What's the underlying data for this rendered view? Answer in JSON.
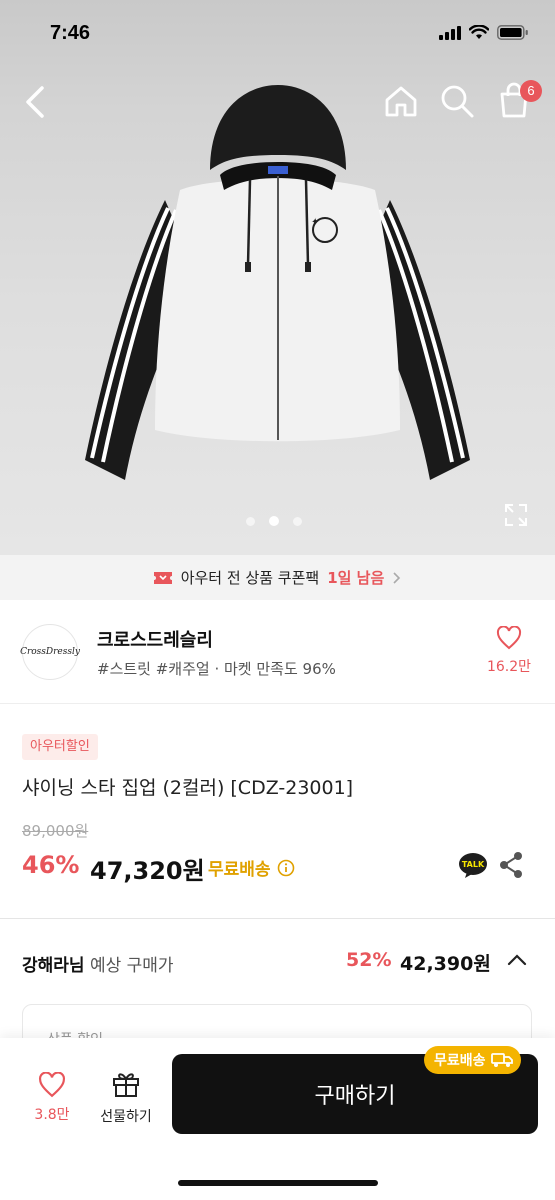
{
  "status": {
    "time": "7:46"
  },
  "nav": {
    "cart_count": "6"
  },
  "coupon": {
    "text": "아우터 전 상품 쿠폰팩",
    "remaining": "1일 남음"
  },
  "seller": {
    "logo_text": "CrossDressly",
    "name": "크로스드레슬리",
    "tags": "#스트릿 #캐주얼 · 마켓 만족도 96%",
    "likes": "16.2만"
  },
  "product": {
    "badge": "아우터할인",
    "title": "샤이닝 스타 집업 (2컬러) [CDZ-23001]",
    "original_price": "89,000원",
    "discount_rate": "46%",
    "sale_price": "47,320원",
    "free_shipping": "무료배송",
    "talk_label": "TALK"
  },
  "expected": {
    "user": "강해라님",
    "label": "예상 구매가",
    "rate": "52%",
    "price": "42,390원"
  },
  "detail_box": {
    "label": "상품 할인"
  },
  "bottom_bar": {
    "likes": "3.8만",
    "gift_label": "선물하기",
    "buy_label": "구매하기",
    "free_shipping_badge": "무료배송"
  },
  "carousel": {
    "total": 3,
    "active_index": 1
  },
  "colors": {
    "accent": "#e8565b",
    "ship": "#f4b400",
    "dark": "#111111"
  }
}
